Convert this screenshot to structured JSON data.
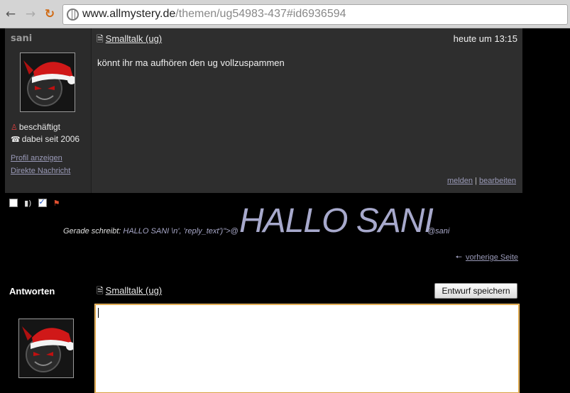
{
  "browser": {
    "url_domain": "www.allmystery.de",
    "url_path": "/themen/ug54983-437#id6936594",
    "icons": [
      "back-arrow-icon",
      "forward-arrow-icon",
      "reload-icon",
      "globe-icon"
    ]
  },
  "post": {
    "username": "sani",
    "status_busy": "beschäftigt",
    "member_since": "dabei seit 2006",
    "profile_link": "Profil anzeigen",
    "message_link": "Direkte Nachricht",
    "topic": "Smalltalk (ug)",
    "timestamp": "heute um 13:15",
    "message": "könnt ihr ma aufhören den ug vollzuspammen",
    "action_report": "melden",
    "action_separator": "|",
    "action_edit": "bearbeiten"
  },
  "typing": {
    "label": "Gerade schreibt:",
    "raw": "HALLO SANI \\n', 'reply_text')\">@",
    "big_text": "HALLO SANI",
    "at_user": "@sani"
  },
  "nav": {
    "previous_page": "vorherige Seite"
  },
  "reply": {
    "heading": "Antworten",
    "topic": "Smalltalk (ug)",
    "draft_button": "Entwurf speichern",
    "text_value": ""
  },
  "colors": {
    "page_bg": "#000000",
    "post_bg": "#2e2e2e",
    "link": "#9a9ab8",
    "big_text": "#a7a9cc",
    "reply_border": "#d8a040"
  }
}
